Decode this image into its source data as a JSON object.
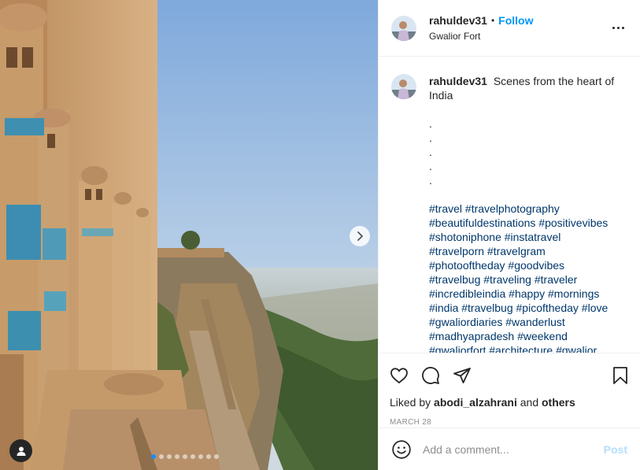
{
  "post": {
    "username": "rahuldev31",
    "follow_label": "Follow",
    "location": "Gwalior Fort",
    "caption": {
      "username": "rahuldev31",
      "text": "Scenes from the heart of India",
      "dots": [
        ".",
        ".",
        ".",
        ".",
        "."
      ],
      "hashtags": [
        "#travel #travelphotography",
        "#beautifuldestinations #positivevibes",
        "#shotoniphone #instatravel",
        "#travelporn #travelgram",
        "#photooftheday #goodvibes",
        "#travelbug #traveling #traveler",
        "#incredibleindia #happy #mornings",
        "#india #travelbug #picoftheday #love",
        "#gwaliordiaries #wanderlust",
        "#madhyapradesh #weekend",
        "#gwaliorfort #architecture #gwalior"
      ]
    },
    "liked_by": {
      "prefix": "Liked by",
      "user": "abodi_alzahrani",
      "joiner": "and",
      "others": "others"
    },
    "date": "MARCH 28",
    "comment_placeholder": "Add a comment...",
    "post_label": "Post",
    "carousel": {
      "count": 9,
      "active_index": 0
    }
  },
  "icons": {
    "more": "more-options-icon",
    "like": "heart-icon",
    "comment": "comment-icon",
    "share": "share-icon",
    "save": "bookmark-icon",
    "emoji": "emoji-icon",
    "next": "chevron-right-icon",
    "tag": "user-tag-icon"
  },
  "colors": {
    "accent": "#0095f6",
    "hashtag": "#00376b",
    "muted": "#8e8e8e",
    "post_disabled": "#b2dffc",
    "sky": "#8fb6e3"
  }
}
